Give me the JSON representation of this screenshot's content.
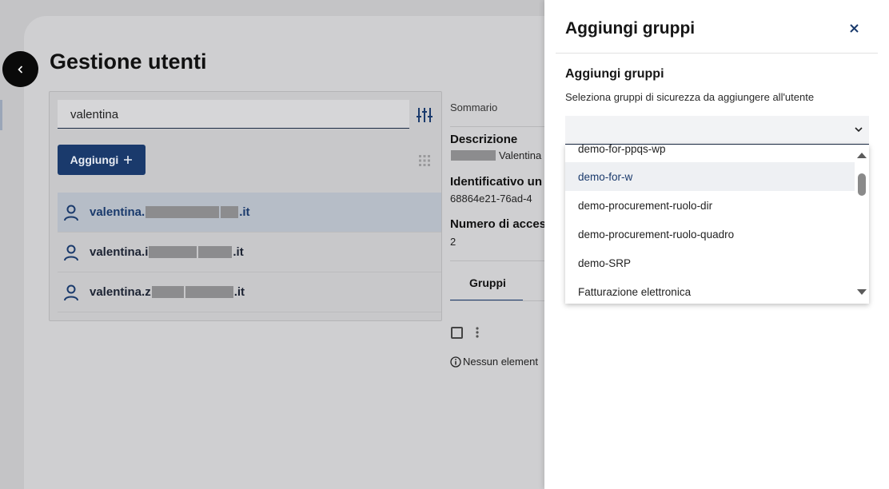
{
  "page": {
    "title": "Gestione utenti",
    "search_value": "valentina",
    "add_button_label": "Aggiungi",
    "add_button_icon": "plus-icon",
    "users": [
      {
        "prefix": "valentina.",
        "suffix": ".it",
        "selected": true
      },
      {
        "prefix": "valentina.i",
        "suffix": ".it",
        "selected": false
      },
      {
        "prefix": "valentina.z",
        "suffix": ".it",
        "selected": false
      }
    ]
  },
  "detail": {
    "summary": "Sommario",
    "description_label": "Descrizione",
    "description_value": "Valentina",
    "identifier_label": "Identificativo un",
    "identifier_value": "68864e21-76ad-4",
    "access_label": "Numero di acces",
    "access_value": "2",
    "tab_groups": "Gruppi",
    "empty_text": "Nessun element"
  },
  "side_panel": {
    "title": "Aggiungi gruppi",
    "subtitle": "Aggiungi gruppi",
    "description": "Seleziona gruppi di sicurezza da aggiungere all'utente",
    "select_value": "",
    "options": [
      "demo-for-ppqs-wp",
      "demo-for-w",
      "demo-procurement-ruolo-dir",
      "demo-procurement-ruolo-quadro",
      "demo-SRP",
      "Fatturazione elettronica"
    ],
    "hovered_option": "demo-for-w"
  },
  "colors": {
    "primary": "#1a3a6c",
    "overlay": "#c4c4c6",
    "panel": "#ffffff"
  }
}
